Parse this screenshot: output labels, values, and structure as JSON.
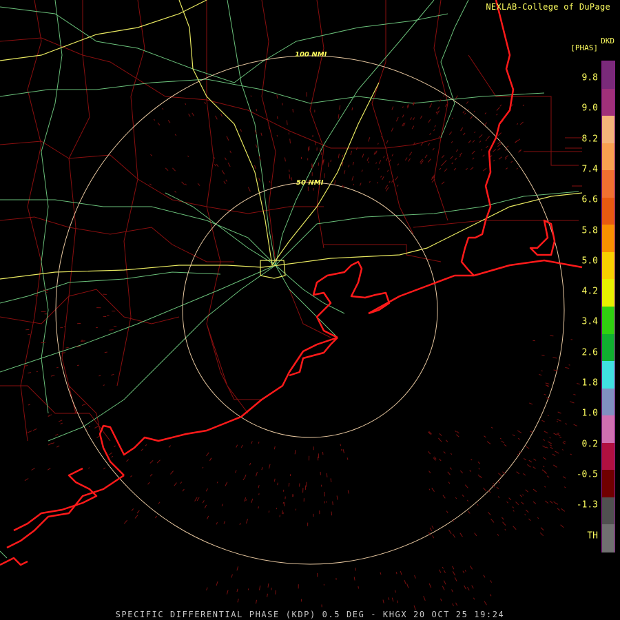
{
  "header": {
    "credit": "NEXLAB-College of DuPage",
    "product_code": "DKD",
    "units": "[PHAS]"
  },
  "rings": [
    {
      "label": "100 NMI"
    },
    {
      "label": "50 NMI"
    }
  ],
  "colorbar": {
    "labels": [
      "9.8",
      "9.0",
      "8.2",
      "7.4",
      "6.6",
      "5.8",
      "5.0",
      "4.2",
      "3.4",
      "2.6",
      "1.8",
      "1.0",
      "0.2",
      "-0.5",
      "-1.3",
      "TH"
    ],
    "colors": [
      "#7a2a7a",
      "#a0307a",
      "#f4b47a",
      "#f8a050",
      "#f07030",
      "#e85a10",
      "#f89000",
      "#f8d000",
      "#e8f000",
      "#30d010",
      "#10b030",
      "#40e0e0",
      "#8090c0",
      "#d070b0",
      "#b01040",
      "#700000",
      "#505050",
      "#707070"
    ]
  },
  "caption": "SPECIFIC DIFFERENTIAL PHASE (KDP) 0.5 DEG - KHGX 20 OCT 25 19:24"
}
